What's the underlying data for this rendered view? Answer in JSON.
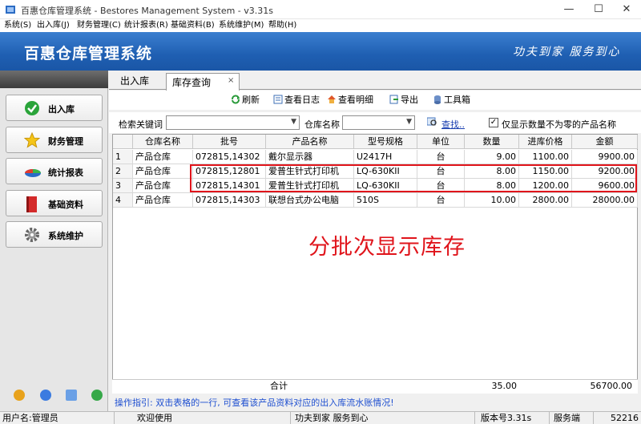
{
  "window": {
    "title": "百惠仓库管理系统 - Bestores Management System - v3.31s",
    "minimize": "—",
    "maximize": "☐",
    "close": "✕"
  },
  "menu": [
    "系统(S)",
    "出入库(J)",
    "财务管理(C)",
    "统计报表(R)",
    "基础资料(B)",
    "系统维护(M)",
    "帮助(H)"
  ],
  "banner": {
    "title": "百惠仓库管理系统",
    "slogan": "功夫到家 服务到心"
  },
  "nav": [
    {
      "label": "出入库",
      "icon": "check-icon"
    },
    {
      "label": "财务管理",
      "icon": "star-icon"
    },
    {
      "label": "统计报表",
      "icon": "pie-chart-icon"
    },
    {
      "label": "基础资料",
      "icon": "book-icon"
    },
    {
      "label": "系统维护",
      "icon": "gear-icon"
    }
  ],
  "tabs": {
    "in_out": "出入库",
    "stock": "库存查询",
    "close": "×"
  },
  "toolbar": {
    "refresh": "刷新",
    "view_log": "查看日志",
    "view_detail": "查看明细",
    "export": "导出",
    "toolbox": "工具箱"
  },
  "search": {
    "keyword_label": "检索关键词",
    "keyword_value": "",
    "warehouse_label": "仓库名称",
    "warehouse_value": "",
    "search_link": "查找..",
    "checkbox_checked": true,
    "checkbox_label": "仅显示数量不为零的产品名称"
  },
  "table": {
    "columns": [
      "",
      "仓库名称",
      "批号",
      "产品名称",
      "型号规格",
      "单位",
      "数量",
      "进库价格",
      "金额"
    ],
    "rows": [
      [
        "1",
        "产品仓库",
        "072815,14302",
        "戴尔显示器",
        "U2417H",
        "台",
        "9.00",
        "1100.00",
        "9900.00"
      ],
      [
        "2",
        "产品仓库",
        "072815,12801",
        "爱普生针式打印机",
        "LQ-630KII",
        "台",
        "8.00",
        "1150.00",
        "9200.00"
      ],
      [
        "3",
        "产品仓库",
        "072815,14301",
        "爱普生针式打印机",
        "LQ-630KII",
        "台",
        "8.00",
        "1200.00",
        "9600.00"
      ],
      [
        "4",
        "产品仓库",
        "072815,14303",
        "联想台式办公电脑",
        "510S",
        "台",
        "10.00",
        "2800.00",
        "28000.00"
      ]
    ],
    "totals": {
      "label": "合计",
      "quantity": "35.00",
      "amount": "56700.00"
    }
  },
  "annotation": "分批次显示库存",
  "hint": "操作指引: 双击表格的一行, 可查看该产品资料对应的出入库流水账情况!",
  "status": {
    "user": "用户名:管理员",
    "welcome": "欢迎使用",
    "slogan": "功夫到家 服务到心",
    "version": "版本号3.31s",
    "client": "服务端",
    "code": "52216"
  },
  "colors": {
    "banner": "#1f5fb2",
    "annotation": "#e0141b",
    "hint": "#1e4fd0"
  }
}
